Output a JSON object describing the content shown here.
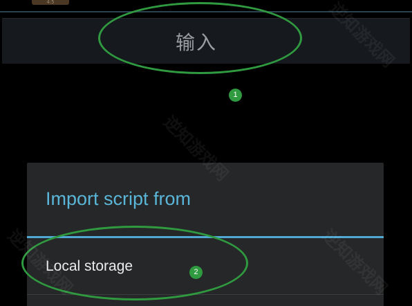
{
  "status_chip": {
    "text": "4:5"
  },
  "input_bar": {
    "label": "输入"
  },
  "annotations": {
    "marker_1": "1",
    "marker_2": "2",
    "ellipse_color": "#2f9a3f"
  },
  "dialog": {
    "title": "Import script from",
    "title_color": "#5ab6d8",
    "accent_color": "#4fa9d4",
    "items": [
      {
        "label": "Local storage"
      }
    ]
  },
  "watermark": {
    "text": "逆知游戏网"
  }
}
